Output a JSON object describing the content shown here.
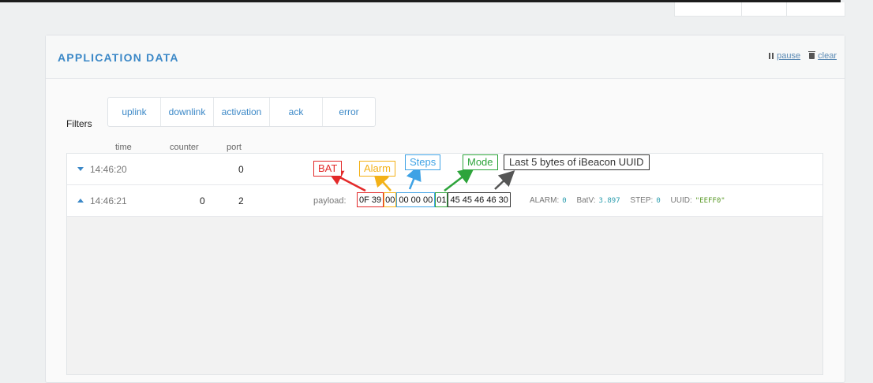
{
  "panel": {
    "title": "APPLICATION DATA",
    "pause_label": "pause",
    "clear_label": "clear"
  },
  "filters": {
    "label": "Filters",
    "buttons": [
      "uplink",
      "downlink",
      "activation",
      "ack",
      "error"
    ]
  },
  "table": {
    "columns": [
      "time",
      "counter",
      "port"
    ],
    "rows": [
      {
        "time": "14:46:20",
        "counter": "",
        "port": "0",
        "expanded": false
      },
      {
        "time": "14:46:21",
        "counter": "0",
        "port": "2",
        "expanded": true,
        "payload_label": "payload:",
        "payload_bytes": [
          "0F 39",
          "00",
          "00 00 00",
          "01",
          "45 45 46 46 30"
        ],
        "decoded": {
          "alarm_key": "ALARM:",
          "alarm_val": "0",
          "batv_key": "BatV:",
          "batv_val": "3.897",
          "step_key": "STEP:",
          "step_val": "0",
          "uuid_key": "UUID:",
          "uuid_val": "\"EEFF0\""
        }
      }
    ]
  },
  "annotations": {
    "bat": "BAT",
    "alarm": "Alarm",
    "steps": "Steps",
    "mode": "Mode",
    "uuid": "Last 5 bytes of iBeacon UUID"
  },
  "colors": {
    "accent": "#3b88c7",
    "bat": "#e32a2a",
    "alarm": "#f3b117",
    "steps": "#3ea2e5",
    "mode": "#2da43b",
    "uuid": "#333333"
  },
  "icons": {
    "pause": "pause-icon",
    "clear": "trash-icon",
    "collapsed_row": "caret-down-icon",
    "expanded_row": "caret-up-icon"
  }
}
